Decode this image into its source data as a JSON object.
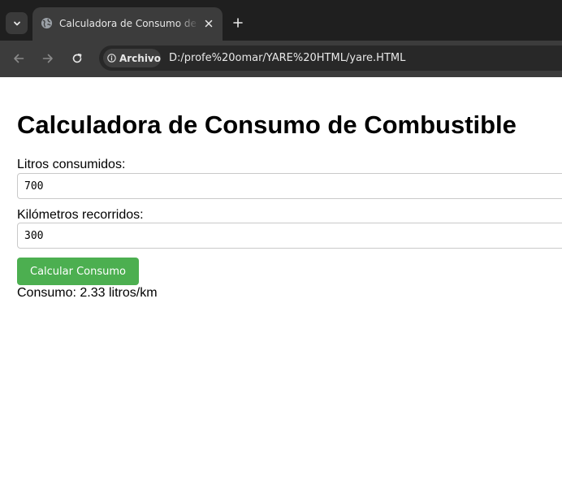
{
  "browser": {
    "tab": {
      "title": "Calculadora de Consumo de Combustible"
    },
    "address_bar": {
      "chip_label": "Archivo",
      "url": "D:/profe%20omar/YARE%20HTML/yare.HTML"
    },
    "colors": {
      "tabstrip": "#1f1f1f",
      "toolbar": "#3c3c3c",
      "omnibox": "#282828"
    }
  },
  "page": {
    "heading": "Calculadora de Consumo de Combustible",
    "liters_field": {
      "label": "Litros consumidos:",
      "value": "700"
    },
    "km_field": {
      "label": "Kilómetros recorridos:",
      "value": "300"
    },
    "calculate_button": {
      "label": "Calcular Consumo",
      "color": "#4caf50"
    },
    "result": {
      "prefix": "Consumo: ",
      "value": "2.33",
      "unit": " litros/km"
    }
  }
}
